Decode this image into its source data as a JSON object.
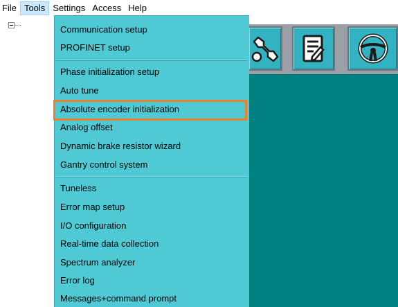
{
  "menubar": {
    "items": [
      "File",
      "Tools",
      "Settings",
      "Access",
      "Help"
    ],
    "active": "Tools"
  },
  "tree": {
    "toggle_symbol": "−"
  },
  "toolbar": {
    "buttons": [
      {
        "icon": "wrench-icon",
        "color": "#ffffff"
      },
      {
        "icon": "document-edit-icon",
        "color": "#ffffff"
      },
      {
        "icon": "steering-wheel-icon",
        "color": "#ffffff"
      }
    ],
    "background": "#33b2c2"
  },
  "tools_menu": {
    "groups": [
      [
        "Communication setup",
        "PROFINET setup"
      ],
      [
        "Phase initialization setup",
        "Auto tune",
        "Absolute encoder initialization",
        "Analog offset",
        "Dynamic brake resistor wizard",
        "Gantry control system"
      ],
      [
        "Tuneless",
        "Error map setup",
        "I/O configuration",
        "Real-time data collection",
        "Spectrum analyzer",
        "Error log",
        "Messages+command prompt"
      ]
    ],
    "highlighted_item": "Absolute encoder initialization",
    "highlight_color": "#f07f2b",
    "background": "#4fc9d4"
  },
  "main_panel": {
    "background": "#008080"
  }
}
